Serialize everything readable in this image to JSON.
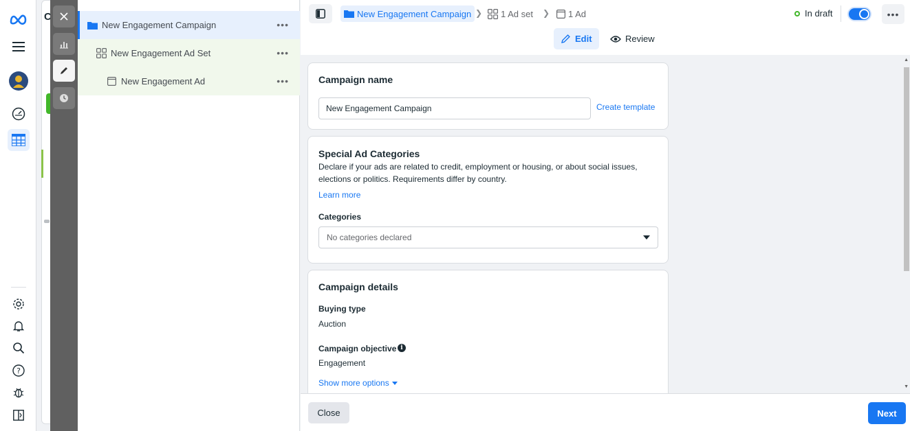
{
  "app": {
    "brand": "meta-logo"
  },
  "background_page": {
    "title_initial": "C"
  },
  "tree": {
    "campaign": {
      "label": "New Engagement Campaign"
    },
    "adset": {
      "label": "New Engagement Ad Set"
    },
    "ad": {
      "label": "New Engagement Ad"
    },
    "more": "•••"
  },
  "header": {
    "breadcrumb": {
      "campaign": "New Engagement Campaign",
      "adset": "1 Ad set",
      "ad": "1 Ad"
    },
    "status": "In draft",
    "more": "•••",
    "tabs": {
      "edit": "Edit",
      "review": "Review"
    }
  },
  "campaign_name": {
    "title": "Campaign name",
    "value": "New Engagement Campaign",
    "create_template": "Create template"
  },
  "special_ad": {
    "title": "Special Ad Categories",
    "description": "Declare if your ads are related to credit, employment or housing, or about social issues, elections or politics. Requirements differ by country.",
    "learn_more": "Learn more",
    "categories_label": "Categories",
    "categories_placeholder": "No categories declared"
  },
  "details": {
    "title": "Campaign details",
    "buying_type_label": "Buying type",
    "buying_type_value": "Auction",
    "objective_label": "Campaign objective",
    "objective_value": "Engagement",
    "show_more": "Show more options"
  },
  "footer": {
    "close": "Close",
    "next": "Next"
  },
  "colors": {
    "accent": "#1877f2",
    "draft_green": "#42b72a",
    "tree_green": "#8bc34a"
  }
}
